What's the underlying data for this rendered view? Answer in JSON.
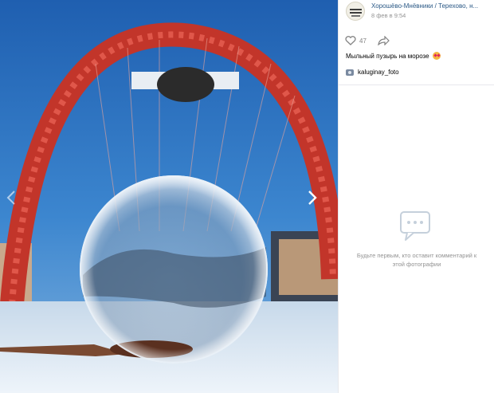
{
  "post": {
    "author": "Хорошёво-Мнёвники / Терехово, н...",
    "date": "8 фев в 9:54",
    "likes": "47",
    "caption": "Мыльный пузырь на морозе",
    "caption_emoji": "heart-eyes-emoji",
    "photo_credit": "kaluginay_foto"
  },
  "comments": {
    "empty_text": "Будьте первым, кто оставит комментарий к этой фотографии"
  },
  "icons": {
    "prev": "chevron-left-icon",
    "next": "chevron-right-icon",
    "like": "heart-icon",
    "share": "share-arrow-icon",
    "comments_empty": "comments-icon",
    "credit": "camera-icon"
  },
  "colors": {
    "link": "#2a5885",
    "muted": "#939393",
    "bridge": "#d23a2a",
    "sky": "#2a6bb8"
  }
}
